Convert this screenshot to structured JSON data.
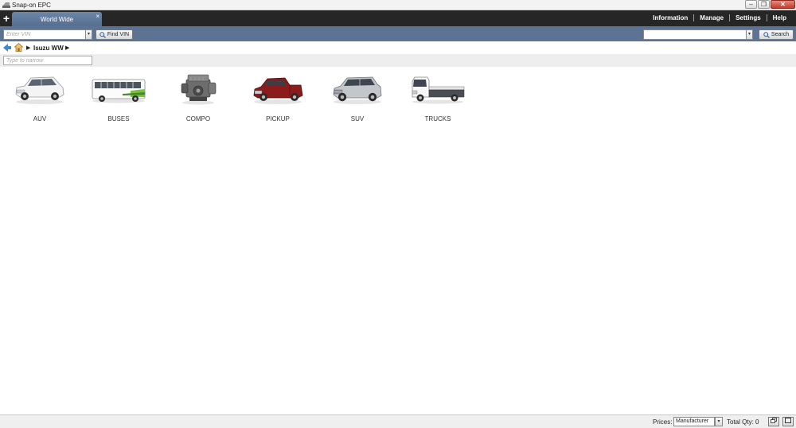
{
  "window": {
    "title": "Snap-on EPC",
    "minimize_glyph": "–",
    "maximize_glyph": "❐",
    "close_glyph": "✕"
  },
  "tabs": {
    "add_glyph": "+",
    "items": [
      {
        "label": "World Wide",
        "close_glyph": "×"
      }
    ]
  },
  "topnav": {
    "information": "Information",
    "manage": "Manage",
    "settings": "Settings",
    "help": "Help"
  },
  "toolbar": {
    "vin_placeholder": "Enter VIN",
    "find_vin_label": "Find VIN",
    "search_value": "",
    "search_label": "Search",
    "dropdown_glyph": "▾"
  },
  "breadcrumb": {
    "arrow": "▶",
    "crumb": "Isuzu WW"
  },
  "filter": {
    "placeholder": "Type to narrow"
  },
  "catalog": {
    "items": [
      {
        "label": "AUV",
        "icon": "auv-vehicle-icon"
      },
      {
        "label": "BUSES",
        "icon": "bus-vehicle-icon"
      },
      {
        "label": "COMPO",
        "icon": "engine-component-icon"
      },
      {
        "label": "PICKUP",
        "icon": "pickup-truck-icon"
      },
      {
        "label": "SUV",
        "icon": "suv-vehicle-icon"
      },
      {
        "label": "TRUCKS",
        "icon": "light-truck-icon"
      }
    ]
  },
  "status": {
    "prices_label": "Prices:",
    "prices_value": "Manufacturer",
    "total_qty": "Total Qty: 0"
  },
  "colors": {
    "tabbar": "#262626",
    "toolbar": "#5c7394",
    "tab": "#6c86a8",
    "pickup_body": "#8c1c1c",
    "bus_stripe": "#7bbf3a"
  }
}
